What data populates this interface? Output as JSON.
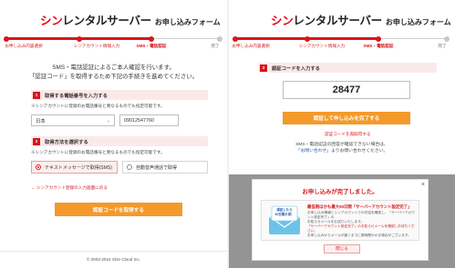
{
  "left": {
    "brand": {
      "red": "シン",
      "rest": "レンタルサーバー",
      "sub": "お申し込みフォーム"
    },
    "steps": [
      {
        "label": "お申し込み内容選択",
        "state": "done"
      },
      {
        "label": "シンアカウント情報入力",
        "state": "done"
      },
      {
        "label": "SMS・電話認証",
        "state": "current"
      },
      {
        "label": "完了",
        "state": "todo"
      }
    ],
    "intro_line1": "SMS・電話認証によるご本人確認を行います。",
    "intro_line2": "「認証コード」を取得するため下記の手続きを進めてください。",
    "section1": {
      "num": "1",
      "title": "取得する電話番号を入力する",
      "note": "※シンアカウントに登録のお電話番号と異なるものでも指定可能です。",
      "country": "日本",
      "phone": "09012547760"
    },
    "section2": {
      "num": "2",
      "title": "取得方法を選択する",
      "note": "※シンアカウントに登録のお電話番号と異なるものでも指定可能です。",
      "option_sms": "テキストメッセージで取得(SMS)",
      "option_voice": "自動音声通話で取得"
    },
    "back_link": "← シンアカウント登録の入力画面に戻る",
    "submit": "認証コードを取得する",
    "copyright": "© 2003-2024 Shin Cloud Inc."
  },
  "right": {
    "brand": {
      "red": "シン",
      "rest": "レンタルサーバー",
      "sub": "お申し込みフォーム"
    },
    "steps": [
      {
        "label": "お申し込み内容選択",
        "state": "done"
      },
      {
        "label": "シンアカウント情報入力",
        "state": "done"
      },
      {
        "label": "SMS・電話認証",
        "state": "current"
      },
      {
        "label": "完了",
        "state": "todo"
      }
    ],
    "section3": {
      "num": "3",
      "title": "認証コードを入力する",
      "code": "28477"
    },
    "complete_btn": "認証して申し込みを完了する",
    "resend_link": "認証コードを再取得する",
    "help_line1": "SMS・電話認証の回答が確認できない場合は、",
    "help_link": "「お問い合わせ」",
    "help_line2": "よりお問い合わせください。",
    "modal": {
      "title": "お申し込みが完了しました。",
      "illustration_label": "認証したら",
      "illustration_label2": "60日間お得！",
      "heading": "最低限ほかも最大60日間「サーバーアカウント設定完了」",
      "body1": "お申し込み情報とシンアカウントでの内容を確認し、「サーバーアカウント設定完了」の",
      "body2": "お知らせメールをお送りいたします。",
      "body3": "「サーバーアカウント設定完了」のお知らせメールを確認しお待ちください。",
      "body4": "お申し込みからメールが届くまでに数時間かかる場合がございます。",
      "close_btn": "閉じる",
      "close_icon": "×"
    }
  },
  "colors": {
    "brand_red": "#e60012",
    "accent_red": "#d8161c",
    "button_orange": "#f39a2b",
    "pink_bg": "#fbe9e9"
  }
}
